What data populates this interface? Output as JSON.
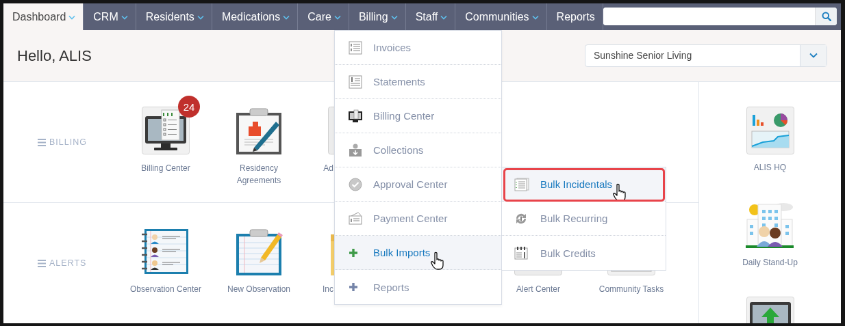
{
  "nav": {
    "tabs": [
      {
        "label": "Dashboard",
        "selected": true,
        "caret": true
      },
      {
        "label": "CRM",
        "selected": false,
        "caret": true
      },
      {
        "label": "Residents",
        "selected": false,
        "caret": true
      },
      {
        "label": "Medications",
        "selected": false,
        "caret": true
      },
      {
        "label": "Care",
        "selected": false,
        "caret": true
      },
      {
        "label": "Billing",
        "selected": false,
        "caret": true
      },
      {
        "label": "Staff",
        "selected": false,
        "caret": true
      },
      {
        "label": "Communities",
        "selected": false,
        "caret": true
      },
      {
        "label": "Reports",
        "selected": false,
        "caret": false
      }
    ]
  },
  "greeting": "Hello, ALIS",
  "community_select": {
    "value": "Sunshine Senior Living"
  },
  "sections": [
    {
      "label": "BILLING",
      "tiles": [
        {
          "label": "Billing Center",
          "kind": "billing-monitor",
          "badge": "24",
          "clipped": false
        },
        {
          "label": "Residency Agreements",
          "kind": "clipboard-pen",
          "clipped": false
        },
        {
          "label": "Ad",
          "kind": "gray-box",
          "clipped": true
        }
      ]
    },
    {
      "label": "ALERTS",
      "tiles": [
        {
          "label": "Observation Center",
          "kind": "notebook",
          "clipped": false
        },
        {
          "label": "New Observation",
          "kind": "notepad",
          "clipped": false
        },
        {
          "label": "Inc",
          "kind": "folder",
          "clipped": true
        },
        {
          "label": "Alert Center",
          "kind": "gray-box",
          "clipped": false
        },
        {
          "label": "Community Tasks",
          "kind": "tasks",
          "clipped": false
        }
      ]
    }
  ],
  "side_tiles": [
    {
      "label": "ALIS HQ",
      "kind": "charts"
    },
    {
      "label": "Daily Stand-Up",
      "kind": "building"
    },
    {
      "kind": "upload"
    }
  ],
  "billing_menu": {
    "items": [
      {
        "label": "Invoices",
        "kind": "invoice",
        "selected": false,
        "pointer": false
      },
      {
        "label": "Statements",
        "kind": "statement",
        "selected": false,
        "pointer": false
      },
      {
        "label": "Billing Center",
        "kind": "monitor",
        "selected": false,
        "pointer": false
      },
      {
        "label": "Collections",
        "kind": "collections",
        "selected": false,
        "pointer": false
      },
      {
        "label": "Approval Center",
        "kind": "approval",
        "selected": false,
        "pointer": false
      },
      {
        "label": "Payment Center",
        "kind": "payment",
        "selected": false,
        "pointer": false
      },
      {
        "label": "Bulk Imports",
        "kind": "plus",
        "selected": true,
        "pointer": true
      },
      {
        "label": "Reports",
        "kind": "plus",
        "selected": false,
        "pointer": false
      }
    ],
    "submenu": {
      "items": [
        {
          "label": "Bulk Incidentals",
          "kind": "incidentals",
          "selected": true,
          "pointer": true,
          "annotated": true
        },
        {
          "label": "Bulk Recurring",
          "kind": "recurring",
          "selected": false,
          "pointer": false,
          "annotated": false
        },
        {
          "label": "Bulk Credits",
          "kind": "credits",
          "selected": false,
          "pointer": false,
          "annotated": false
        }
      ]
    }
  }
}
